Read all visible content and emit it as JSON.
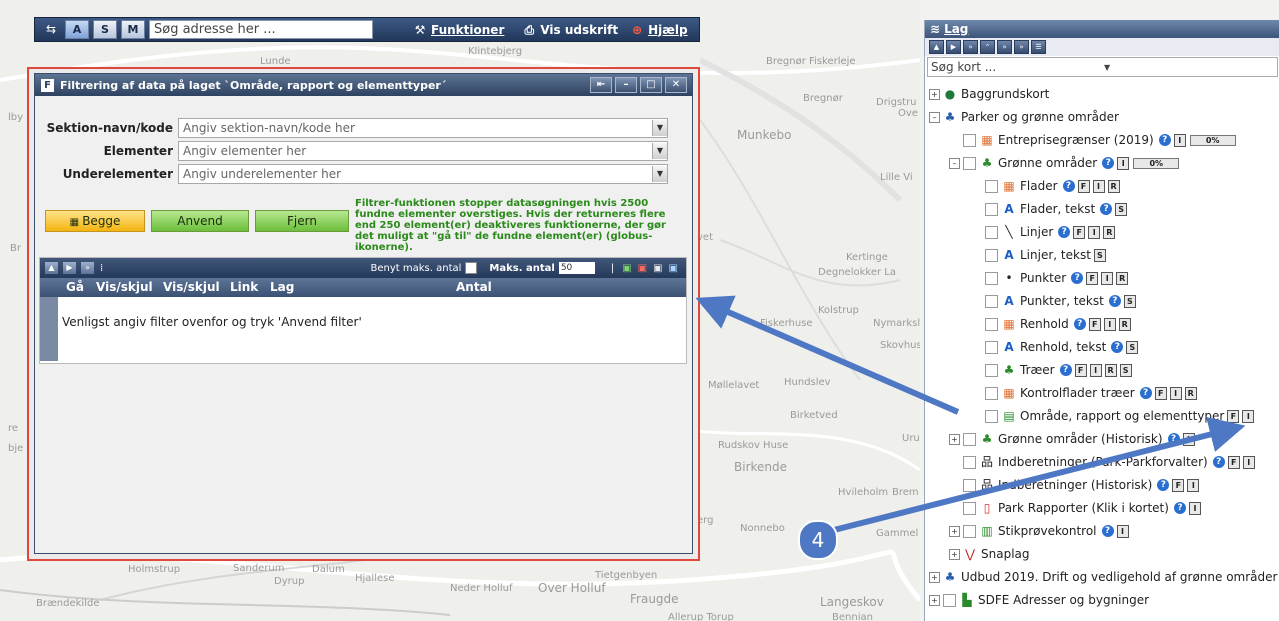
{
  "toolbar": {
    "btn_a": "A",
    "btn_s": "S",
    "btn_m": "M",
    "search_placeholder": "Søg adresse her ...",
    "funktioner": "Funktioner",
    "vis_udskrift": "Vis udskrift",
    "hjaelp": "Hjælp"
  },
  "map_places": {
    "klintebjerg": "Klintebjerg",
    "lunde": "Lunde",
    "bregnor_fiskerleje": "Bregnør Fiskerleje",
    "bregnor": "Bregnør",
    "drigstrup": "Drigstru",
    "ove": "Ove",
    "munkebo": "Munkebo",
    "lille_vi": "Lille Vi",
    "kertinge": "Kertinge",
    "degnelokker": "Degnelokker La",
    "kolstrup": "Kolstrup",
    "fiskerhuse": "Fiskerhuse",
    "nymarks": "Nymarksl",
    "skovhus": "Skovhus",
    "mollelavet": "Møllelavet",
    "hundslev": "Hundslev",
    "birketved": "Birketved",
    "uru": "Uru",
    "rudskov": "Rudskov Huse",
    "birkende": "Birkende",
    "hvileholm": "Hvileholm",
    "bren": "Brem",
    "nonnebo": "Nonnebo",
    "gammel": "Gammel",
    "sanderum": "Sanderum",
    "hjallese": "Hjallese",
    "neder_holluf": "Neder Holluf",
    "over_holluf": "Over Holluf",
    "tietgenbyen": "Tietgenbyen",
    "fraugde": "Fraugde",
    "langeskov": "Langeskov",
    "holmstrup": "Holmstrup",
    "dalum": "Dalum",
    "dyrup": "Dyrup",
    "braendekilde": "Brændekilde",
    "bro": "Br",
    "vet": "vet",
    "erg": "erg",
    "ebje": "bje",
    "re": "re",
    "lby": "lby",
    "alleruo": "Allerup Torup",
    "bennian": "Bennian"
  },
  "dialog": {
    "title": "Filtrering af data på laget `Område, rapport og elementtyper´",
    "rows": [
      {
        "label": "Sektion-navn/kode",
        "placeholder": "Angiv sektion-navn/kode her"
      },
      {
        "label": "Elementer",
        "placeholder": "Angiv elementer her"
      },
      {
        "label": "Underelementer",
        "placeholder": "Angiv underelementer her"
      }
    ],
    "btn_begge": "Begge",
    "btn_anvend": "Anvend",
    "btn_fjern": "Fjern",
    "note": "Filtrer-funktionen stopper datasøgningen hvis 2500 fundne elementer overstiges. Hvis der returneres flere end 250 element(er) deaktiveres funktionerne, der gør det muligt at \"gå til\" de fundne element(er) (globus-ikonerne).",
    "grid": {
      "benyt_maks": "Benyt maks. antal",
      "maks_antal_label": "Maks. antal",
      "maks_antal_value": "50",
      "columns": [
        "Gå",
        "Vis/skjul",
        "Vis/skjul",
        "Link",
        "Lag",
        "Antal"
      ],
      "empty_message": "Venligst angiv filter ovenfor og tryk 'Anvend filter'"
    }
  },
  "panel": {
    "title": "Lag",
    "search_placeholder": "Søg kort ...",
    "nodes": [
      {
        "label": "Baggrundskort"
      },
      {
        "label": "Parker og grønne områder"
      },
      {
        "label": "Entreprisegrænser (2019)",
        "pct": "0%"
      },
      {
        "label": "Grønne områder",
        "pct": "0%"
      },
      {
        "label": "Flader"
      },
      {
        "label": "Flader, tekst"
      },
      {
        "label": "Linjer"
      },
      {
        "label": "Linjer, tekst"
      },
      {
        "label": "Punkter"
      },
      {
        "label": "Punkter, tekst"
      },
      {
        "label": "Renhold"
      },
      {
        "label": "Renhold, tekst"
      },
      {
        "label": "Træer"
      },
      {
        "label": "Kontrolflader træer"
      },
      {
        "label": "Område, rapport og elementtyper"
      },
      {
        "label": "Grønne områder (Historisk)"
      },
      {
        "label": "Indberetninger (Park-Parkforvalter)"
      },
      {
        "label": "Indberetninger (Historisk)"
      },
      {
        "label": "Park Rapporter (Klik i kortet)"
      },
      {
        "label": "Stikprøvekontrol"
      },
      {
        "label": "Snaplag"
      },
      {
        "label": "Udbud 2019. Drift og vedligehold af grønne områder"
      },
      {
        "label": "SDFE Adresser og bygninger"
      }
    ],
    "badges": {
      "f": "F",
      "i": "I",
      "r": "R",
      "s": "S"
    }
  },
  "callout": "4",
  "colors": {
    "arrow": "#4f78c4",
    "highlight": "#e0483c",
    "title_bar": "#2e4360"
  }
}
